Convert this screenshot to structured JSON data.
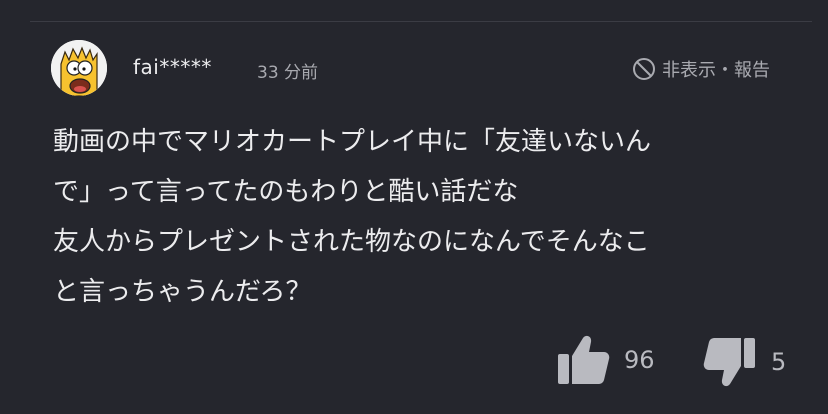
{
  "comment": {
    "username": "fai*****",
    "time": "33 分前",
    "hide_report_label": "非表示・報告",
    "body_lines": [
      "動画の中でマリオカートプレイ中に「友達いないん",
      "で」って言ってたのもわりと酷い話だな",
      "友人からプレゼントされた物なのになんでそんなこ",
      "と言っちゃうんだろ？"
    ],
    "likes": "96",
    "dislikes": "5"
  },
  "icons": {
    "avatar": "avatar-cartoon",
    "hide": "no-entry-icon",
    "like": "thumbs-up-icon",
    "dislike": "thumbs-down-icon"
  },
  "colors": {
    "background": "#25262d",
    "text": "#ececee",
    "muted": "#a9aab0",
    "divider": "#3b3c44"
  }
}
